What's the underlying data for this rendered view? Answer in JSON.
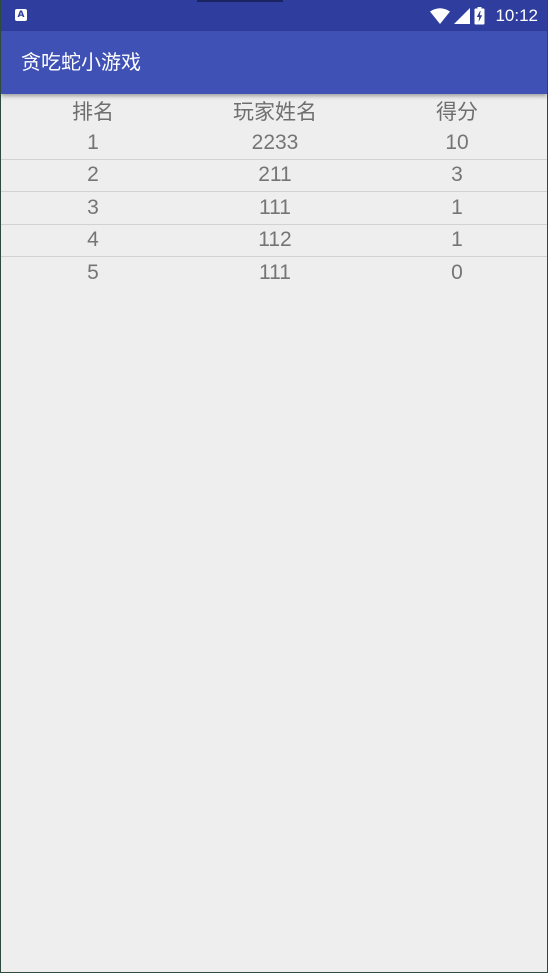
{
  "status_bar": {
    "notification_icon": "a-icon",
    "notification_letter": "A",
    "wifi_icon": "wifi-icon",
    "signal_icon": "cell-signal-icon",
    "battery_icon": "battery-charging-icon",
    "time": "10:12"
  },
  "app_bar": {
    "title": "贪吃蛇小游戏"
  },
  "leaderboard": {
    "headers": {
      "rank": "排名",
      "player_name": "玩家姓名",
      "score": "得分"
    },
    "rows": [
      {
        "rank": "1",
        "player_name": "2233",
        "score": "10"
      },
      {
        "rank": "2",
        "player_name": "211",
        "score": "3"
      },
      {
        "rank": "3",
        "player_name": "111",
        "score": "1"
      },
      {
        "rank": "4",
        "player_name": "112",
        "score": "1"
      },
      {
        "rank": "5",
        "player_name": "111",
        "score": "0"
      }
    ]
  },
  "colors": {
    "status_bar": "#2f3e9e",
    "app_bar": "#3f51b5",
    "background": "#eeeeee",
    "text": "#757575"
  }
}
